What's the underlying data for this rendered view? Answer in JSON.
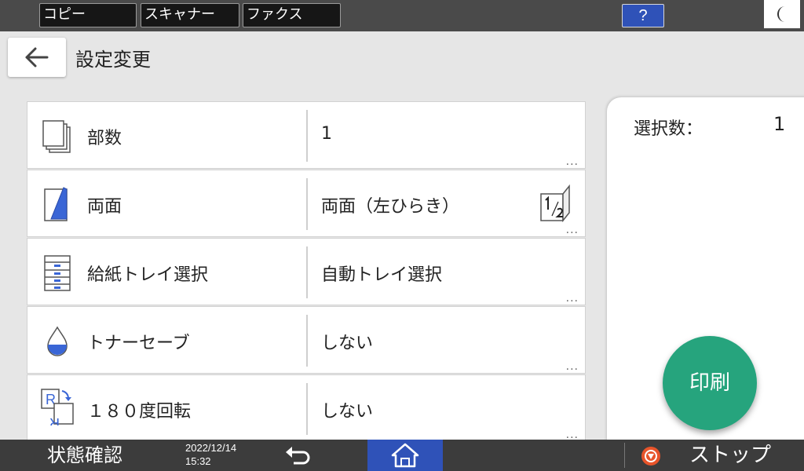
{
  "top_tabs": [
    {
      "label": "コピー"
    },
    {
      "label": "スキャナー"
    },
    {
      "label": "ファクス"
    }
  ],
  "help": {
    "label": "?"
  },
  "header": {
    "title": "設定変更"
  },
  "settings": [
    {
      "label": "部数",
      "value": "1",
      "icon": "copies-icon"
    },
    {
      "label": "両面",
      "value": "両面（左ひらき）",
      "icon": "duplex-icon"
    },
    {
      "label": "給紙トレイ選択",
      "value": "自動トレイ選択",
      "icon": "paper-tray-icon"
    },
    {
      "label": "トナーセーブ",
      "value": "しない",
      "icon": "toner-drop-icon"
    },
    {
      "label": "１８０度回転",
      "value": "しない",
      "icon": "rotate-180-icon"
    }
  ],
  "more_label": "...",
  "selection": {
    "label": "選択数：",
    "count": "1"
  },
  "print_button": {
    "label": "印刷"
  },
  "status_bar": {
    "status_label": "状態確認",
    "date": "2022/12/14",
    "time": "15:32",
    "stop_label": "ストップ"
  },
  "colors": {
    "accent_blue": "#2f52b8",
    "print_green": "#26a47d",
    "stop_orange": "#e8542a"
  }
}
